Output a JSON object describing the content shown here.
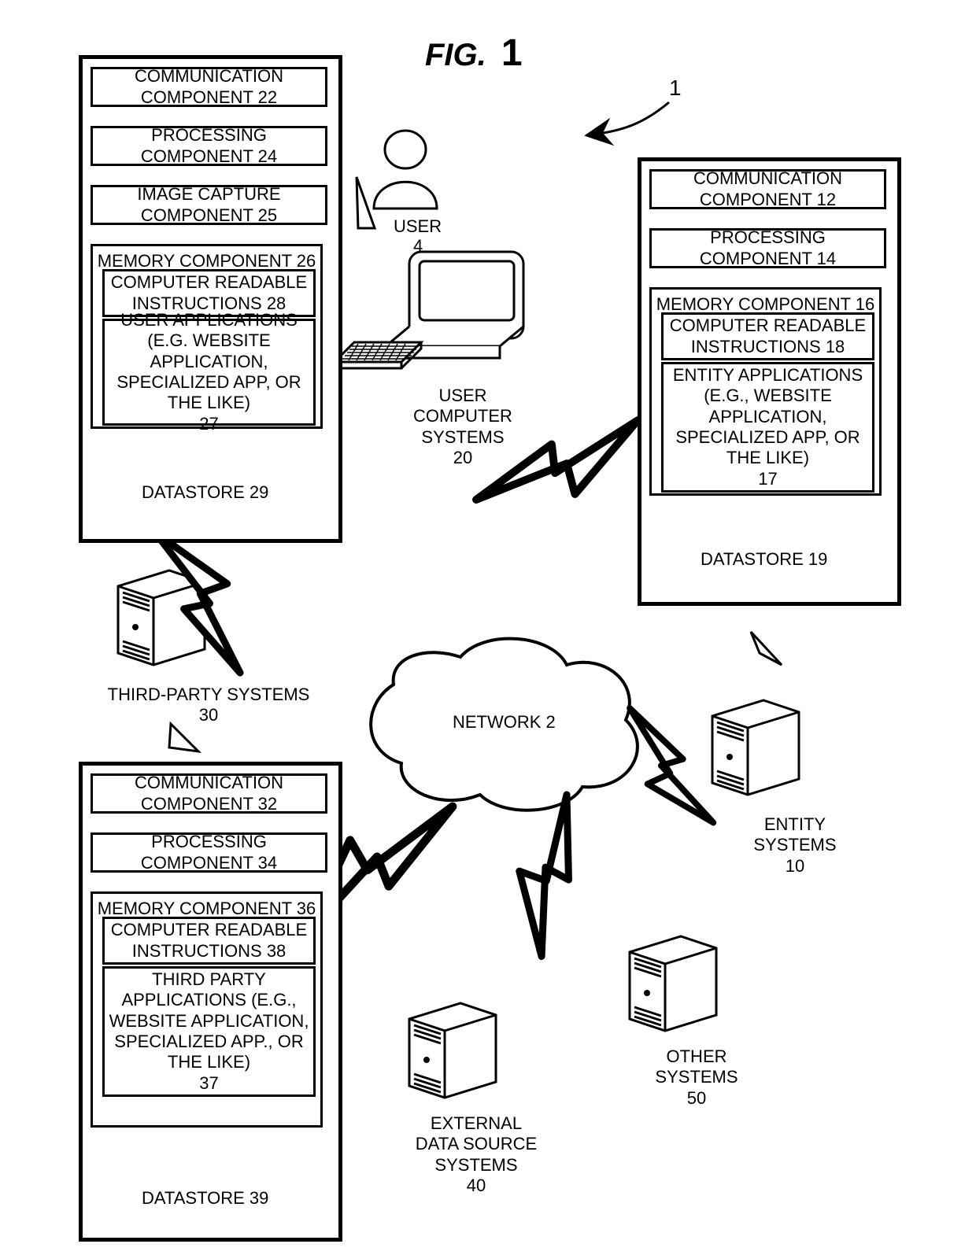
{
  "figure": {
    "title_prefix": "FIG.",
    "title_num": "1",
    "ref": "1"
  },
  "user": {
    "label": "USER",
    "num": "4"
  },
  "ucs": {
    "label_l1": "USER",
    "label_l2": "COMPUTER",
    "label_l3": "SYSTEMS",
    "num": "20"
  },
  "box20": {
    "c1": "COMMUNICATION COMPONENT 22",
    "c2": "PROCESSING COMPONENT 24",
    "c3": "IMAGE CAPTURE COMPONENT 25",
    "mem": "MEMORY COMPONENT 26",
    "cri": "COMPUTER READABLE INSTRUCTIONS 28",
    "apps": "USER APPLICATIONS (E.G. WEBSITE APPLICATION, SPECIALIZED APP, OR THE LIKE)\n27",
    "ds": "DATASTORE 29"
  },
  "entity": {
    "label_l1": "ENTITY",
    "label_l2": "SYSTEMS",
    "num": "10"
  },
  "box10": {
    "c1": "COMMUNICATION COMPONENT 12",
    "c2": "PROCESSING COMPONENT  14",
    "mem": "MEMORY COMPONENT  16",
    "cri": "COMPUTER READABLE INSTRUCTIONS 18",
    "apps": "ENTITY APPLICATIONS (E.G., WEBSITE APPLICATION, SPECIALIZED APP, OR THE LIKE)\n17",
    "ds": "DATASTORE 19"
  },
  "tp": {
    "label": "THIRD-PARTY SYSTEMS",
    "num": "30"
  },
  "box30": {
    "c1": "COMMUNICATION COMPONENT 32",
    "c2": "PROCESSING COMPONENT 34",
    "mem": "MEMORY COMPONENT 36",
    "cri": "COMPUTER READABLE INSTRUCTIONS 38",
    "apps": "THIRD PARTY APPLICATIONS  (E.G., WEBSITE APPLICATION, SPECIALIZED APP., OR THE LIKE)\n37",
    "ds": "DATASTORE 39"
  },
  "network": {
    "label": "NETWORK 2"
  },
  "ext": {
    "l1": "EXTERNAL",
    "l2": "DATA SOURCE",
    "l3": "SYSTEMS",
    "num": "40"
  },
  "other": {
    "l1": "OTHER",
    "l2": "SYSTEMS",
    "num": "50"
  }
}
